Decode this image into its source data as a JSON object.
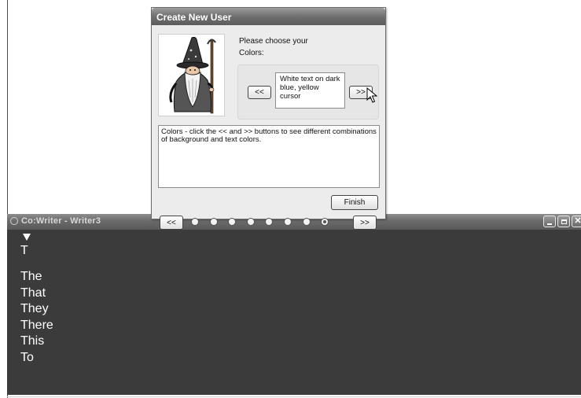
{
  "writer": {
    "title": "Co:Writer - Writer3",
    "typed_text": "T",
    "predictions": [
      "The",
      "That",
      "They",
      "There",
      "This",
      "To"
    ]
  },
  "dialog": {
    "title": "Create New User",
    "prompt_line1": "Please choose your",
    "prompt_line2": "Colors:",
    "color_option": "White text on dark blue, yellow cursor",
    "prev_color_label": "<<",
    "next_color_label": ">>",
    "help_text": "Colors - click the << and >> buttons to see different combinations of background and text colors.",
    "finish_label": "Finish",
    "prev_page_label": "<<",
    "next_page_label": ">>",
    "page_count": 8,
    "current_page": 8
  },
  "icons": {
    "writer": "app-circle-icon",
    "minimize": "minimize-icon",
    "maximize": "maximize-icon",
    "close": "close-icon",
    "cursor": "mouse-pointer-icon",
    "wizard": "wizard-illustration"
  },
  "colors": {
    "writer_background": "#3b3b3b",
    "writer_text": "#ffffff"
  }
}
